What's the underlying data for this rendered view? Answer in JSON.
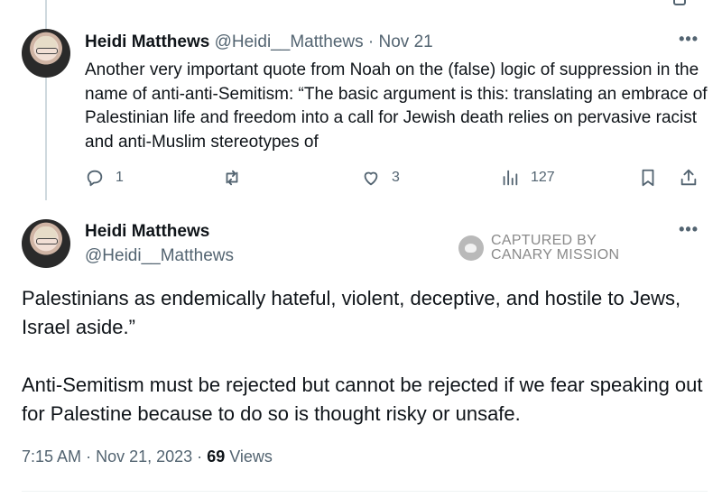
{
  "tweet1": {
    "author_name": "Heidi Matthews",
    "handle": "@Heidi__Matthews",
    "separator": "·",
    "date": "Nov 21",
    "text": "Another very important quote from Noah on the (false) logic of suppression in the name of anti-anti-Semitism: “The basic argument is this: translating an embrace of Palestinian life and freedom into a call for Jewish death relies on pervasive racist and anti-Muslim stereotypes of",
    "more_label": "•••",
    "actions": {
      "reply_count": "1",
      "retweet_count": "",
      "like_count": "3",
      "views_count": "127"
    }
  },
  "tweet2": {
    "author_name": "Heidi Matthews",
    "handle": "@Heidi__Matthews",
    "more_label": "•••",
    "text_p1": "Palestinians as endemically hateful, violent, deceptive, and hostile to Jews, Israel aside.”",
    "text_p2": "Anti-Semitism must be rejected but cannot be rejected if we fear speaking out for Palestine because to do so is thought risky or unsafe.",
    "time": "7:15 AM",
    "separator": "·",
    "date": "Nov 21, 2023",
    "views_count": "69",
    "views_label": "Views"
  },
  "watermark": {
    "line1": "CAPTURED BY",
    "line2": "CANARY MISSION"
  },
  "icons": [
    "reply-icon",
    "retweet-icon",
    "like-icon",
    "views-icon",
    "bookmark-icon",
    "share-icon",
    "more-icon",
    "canary-logo"
  ],
  "colors": {
    "text": "#0f1419",
    "muted": "#536471",
    "thread_line": "#cfd9de",
    "watermark": "#8a8a8a"
  }
}
